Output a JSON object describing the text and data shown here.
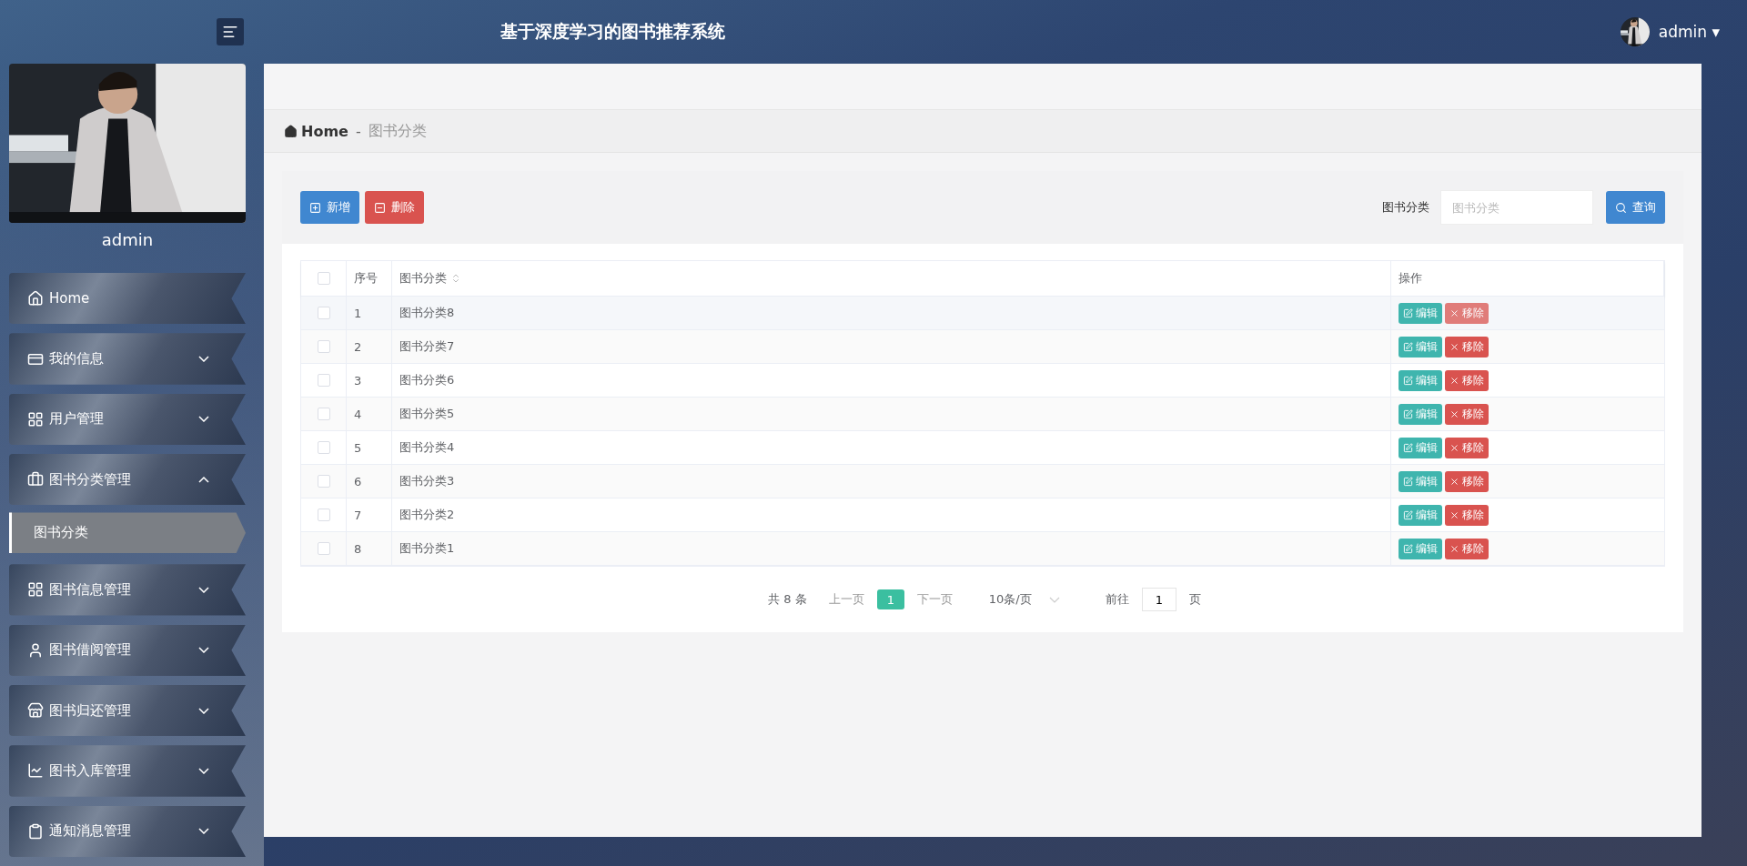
{
  "header": {
    "title": "基于深度学习的图书推荐系统",
    "user": "admin",
    "menu_caret": "▾"
  },
  "profile": {
    "name": "admin"
  },
  "sidebar": {
    "items": [
      {
        "kind": "link",
        "label": "Home"
      },
      {
        "kind": "group",
        "label": "我的信息",
        "expanded": false
      },
      {
        "kind": "group",
        "label": "用户管理",
        "expanded": false
      },
      {
        "kind": "group",
        "label": "图书分类管理",
        "expanded": true,
        "children": [
          {
            "label": "图书分类",
            "selected": true
          }
        ]
      },
      {
        "kind": "group",
        "label": "图书信息管理",
        "expanded": false
      },
      {
        "kind": "group",
        "label": "图书借阅管理",
        "expanded": false
      },
      {
        "kind": "group",
        "label": "图书归还管理",
        "expanded": false
      },
      {
        "kind": "group",
        "label": "图书入库管理",
        "expanded": false
      },
      {
        "kind": "group",
        "label": "通知消息管理",
        "expanded": false
      }
    ]
  },
  "breadcrumb": {
    "home": "Home",
    "separator": "-",
    "current": "图书分类"
  },
  "toolbar": {
    "add": "新增",
    "delete": "删除",
    "search_label": "图书分类",
    "search_placeholder": "图书分类",
    "search_button": "查询"
  },
  "table": {
    "header_checked": false,
    "columns": [
      "序号",
      "图书分类",
      "操作"
    ],
    "rows": [
      {
        "index": "1",
        "name": "图书分类8",
        "checked": false,
        "hovered": true,
        "edit": "编辑",
        "remove": "移除"
      },
      {
        "index": "2",
        "name": "图书分类7",
        "checked": false,
        "hovered": false,
        "edit": "编辑",
        "remove": "移除"
      },
      {
        "index": "3",
        "name": "图书分类6",
        "checked": false,
        "hovered": false,
        "edit": "编辑",
        "remove": "移除"
      },
      {
        "index": "4",
        "name": "图书分类5",
        "checked": false,
        "hovered": false,
        "edit": "编辑",
        "remove": "移除"
      },
      {
        "index": "5",
        "name": "图书分类4",
        "checked": false,
        "hovered": false,
        "edit": "编辑",
        "remove": "移除"
      },
      {
        "index": "6",
        "name": "图书分类3",
        "checked": false,
        "hovered": false,
        "edit": "编辑",
        "remove": "移除"
      },
      {
        "index": "7",
        "name": "图书分类2",
        "checked": false,
        "hovered": false,
        "edit": "编辑",
        "remove": "移除"
      },
      {
        "index": "8",
        "name": "图书分类1",
        "checked": false,
        "hovered": false,
        "edit": "编辑",
        "remove": "移除"
      }
    ]
  },
  "pagination": {
    "total": "共 8 条",
    "prev": "上一页",
    "pages": [
      {
        "label": "1",
        "selected": true
      }
    ],
    "next": "下一页",
    "page_size": "10条/页",
    "goto_label": "前往",
    "goto_value": "1",
    "goto_suffix": "页"
  }
}
